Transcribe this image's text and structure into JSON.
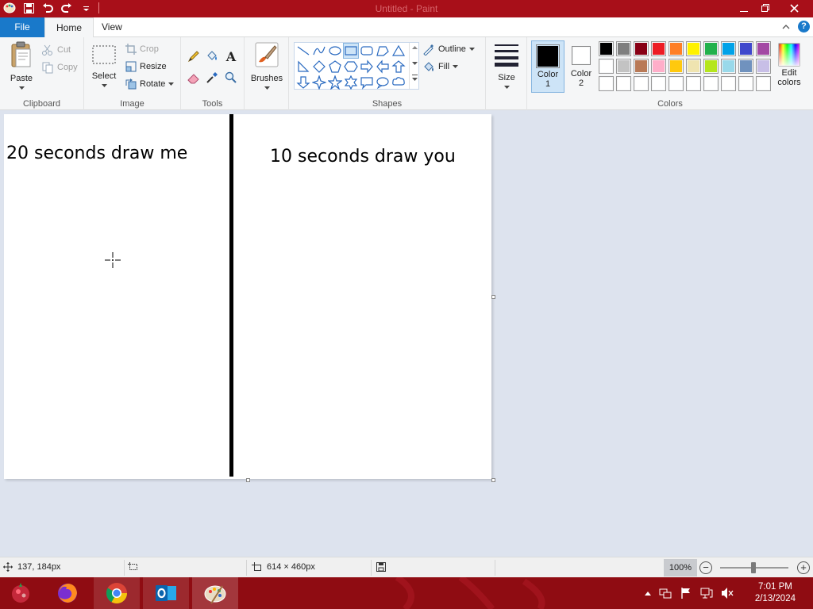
{
  "window": {
    "title": "Untitled - Paint"
  },
  "tabs": {
    "file": "File",
    "home": "Home",
    "view": "View"
  },
  "clipboard": {
    "paste": "Paste",
    "cut": "Cut",
    "copy": "Copy",
    "label": "Clipboard"
  },
  "image": {
    "select": "Select",
    "crop": "Crop",
    "resize": "Resize",
    "rotate": "Rotate",
    "label": "Image"
  },
  "tools": {
    "label": "Tools",
    "text_glyph": "A"
  },
  "brushes": {
    "label": "Brushes"
  },
  "shapes": {
    "outline": "Outline",
    "fill": "Fill",
    "label": "Shapes"
  },
  "size": {
    "label": "Size"
  },
  "colors": {
    "color1_label": "Color",
    "color1_num": "1",
    "color2_label": "Color",
    "color2_num": "2",
    "edit_label": "Edit",
    "edit_label2": "colors",
    "label": "Colors",
    "color1": "#000000",
    "color2": "#ffffff",
    "palette_row1": [
      "#000000",
      "#7f7f7f",
      "#880015",
      "#ed1c24",
      "#ff7f27",
      "#fff200",
      "#22b14c",
      "#00a2e8",
      "#3f48cc",
      "#a349a4"
    ],
    "palette_row2": [
      "#ffffff",
      "#c3c3c3",
      "#b97a57",
      "#ffaec9",
      "#ffc90e",
      "#efe4b0",
      "#b5e61d",
      "#99d9ea",
      "#7092be",
      "#c8bfe7"
    ],
    "palette_row3": [
      "#ffffff",
      "#ffffff",
      "#ffffff",
      "#ffffff",
      "#ffffff",
      "#ffffff",
      "#ffffff",
      "#ffffff",
      "#ffffff",
      "#ffffff"
    ]
  },
  "canvas": {
    "left_text": "20 seconds draw me",
    "right_text": "10 seconds draw you"
  },
  "status": {
    "cursor_pos": "137, 184px",
    "canvas_size": "614 × 460px",
    "zoom": "100%"
  },
  "taskbar": {
    "time": "7:01 PM",
    "date": "2/13/2024"
  }
}
